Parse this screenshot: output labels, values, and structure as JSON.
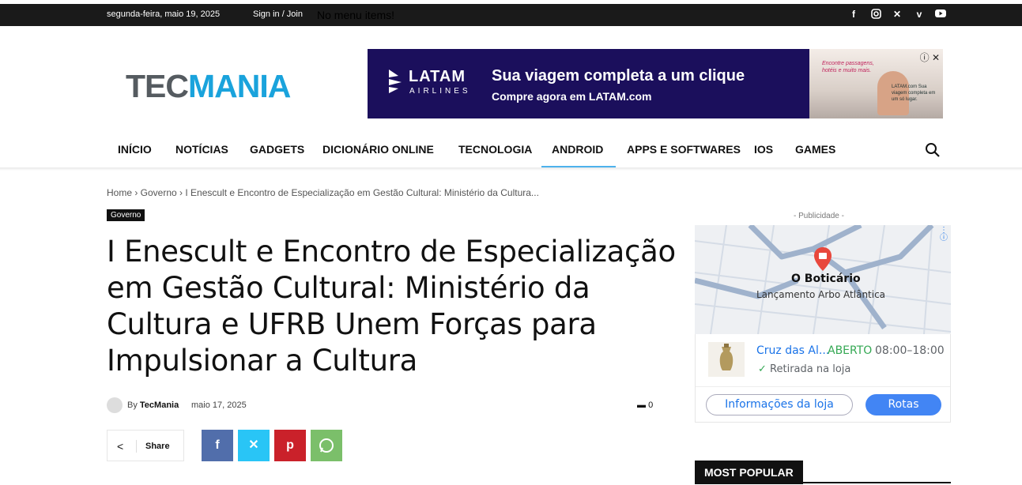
{
  "topbar": {
    "date": "segunda-feira, maio 19, 2025",
    "signin": "Sign in / Join",
    "no_menu": "No menu items!",
    "social_icons": [
      "facebook-icon",
      "instagram-icon",
      "x-icon",
      "vimeo-icon",
      "youtube-icon"
    ]
  },
  "logo": {
    "part1": "TEC",
    "part2": "MANIA"
  },
  "ad": {
    "brand": "LATAM",
    "brand_sub": "AIRLINES",
    "headline": "Sua viagem completa a um clique",
    "subline": "Compre agora em LATAM.com",
    "photo_text": "Encontre passagens, hotéis e muito mais.",
    "photo_text2": "LATAM.com Sua viagem completa em um só lugar."
  },
  "nav": {
    "items": [
      "INÍCIO",
      "NOTÍCIAS",
      "GADGETS",
      "DICIONÁRIO ONLINE",
      "TECNOLOGIA",
      "ANDROID",
      "APPS E SOFTWARES",
      "IOS",
      "GAMES"
    ],
    "active": "ANDROID"
  },
  "breadcrumb": "Home › Governo › I Enescult e Encontro de Especialização em Gestão Cultural: Ministério da Cultura...",
  "category": "Governo",
  "article": {
    "title": "I Enescult e Encontro de Especialização em Gestão Cultural: Ministério da Cultura e UFRB Unem Forças para Impulsionar a Cultura",
    "by": "By",
    "author": "TecMania",
    "date": "maio 17, 2025",
    "comments": "0"
  },
  "share": {
    "label": "Share"
  },
  "sidebar": {
    "publicidade": "- Publicidade -",
    "store_name": "O Boticário",
    "store_place": "Lançamento Arbo Atlântica",
    "branch": "Cruz das Al...",
    "status": "ABERTO",
    "hours": "08:00–18:00",
    "pickup": "Retirada na loja",
    "btn_info": "Informações da loja",
    "btn_route": "Rotas",
    "most_popular": "MOST POPULAR"
  },
  "colors": {
    "accent": "#4db2ec",
    "logo_blue": "#1aa3dc",
    "facebook": "#516eab",
    "twitter": "#29c5f6",
    "pinterest": "#ca212a",
    "whatsapp": "#7bbf6a"
  }
}
